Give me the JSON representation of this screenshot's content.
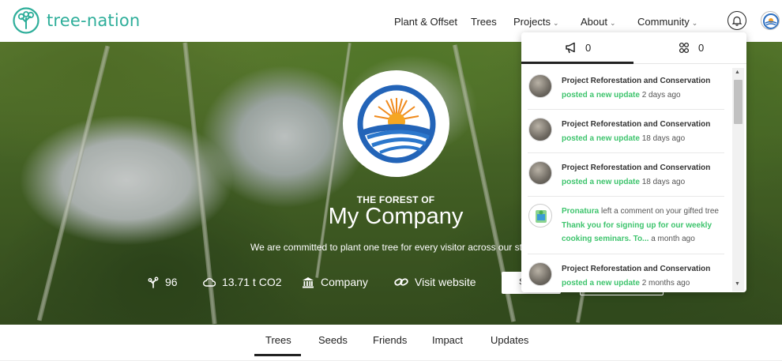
{
  "brand": {
    "name": "tree-nation",
    "color": "#2eae9a"
  },
  "nav": {
    "items": [
      {
        "label": "Plant & Offset",
        "has_caret": false
      },
      {
        "label": "Trees",
        "has_caret": false
      },
      {
        "label": "Projects",
        "has_caret": true
      },
      {
        "label": "About",
        "has_caret": true
      },
      {
        "label": "Community",
        "has_caret": true
      }
    ],
    "caret_glyph": "⌄",
    "bell_icon": "bell-icon",
    "avatar_icon": "user-avatar"
  },
  "hero": {
    "forest_of": "THE FOREST OF",
    "company_name": "My Company",
    "mission": "We are committed to plant one tree for every visitor across our st",
    "stats": [
      {
        "icon": "sprout-icon",
        "value": "96"
      },
      {
        "icon": "cloud-icon",
        "value": "13.71 t CO2"
      },
      {
        "icon": "bank-icon",
        "value": "Company"
      },
      {
        "icon": "link-icon",
        "value": "Visit website"
      }
    ],
    "button_fragment": "S"
  },
  "tabs": {
    "items": [
      "Trees",
      "Seeds",
      "Friends",
      "Impact",
      "Updates"
    ],
    "active": "Trees"
  },
  "notifications": {
    "tab_announcements": {
      "icon": "megaphone-icon",
      "count": "0"
    },
    "tab_community": {
      "icon": "people-icon",
      "count": "0"
    },
    "items": [
      {
        "title": "Project Reforestation and Conservation",
        "action": "posted a new update",
        "time": "2 days ago"
      },
      {
        "title": "Project Reforestation and Conservation",
        "action": "posted a new update",
        "time": "18 days ago"
      },
      {
        "title": "Project Reforestation and Conservation",
        "action": "posted a new update",
        "time": "18 days ago"
      },
      {
        "actor": "Pronatura",
        "title_rest": "left a comment on your gifted tree",
        "comment_1": "Thank you for signing up for our weekly",
        "comment_2": "cooking seminars. To...",
        "time": "a month ago"
      },
      {
        "title": "Project Reforestation and Conservation",
        "action": "posted a new update",
        "time": "2 months ago"
      }
    ]
  },
  "colors": {
    "green_accent": "#3ec46d",
    "brand_teal": "#2eae9a"
  }
}
